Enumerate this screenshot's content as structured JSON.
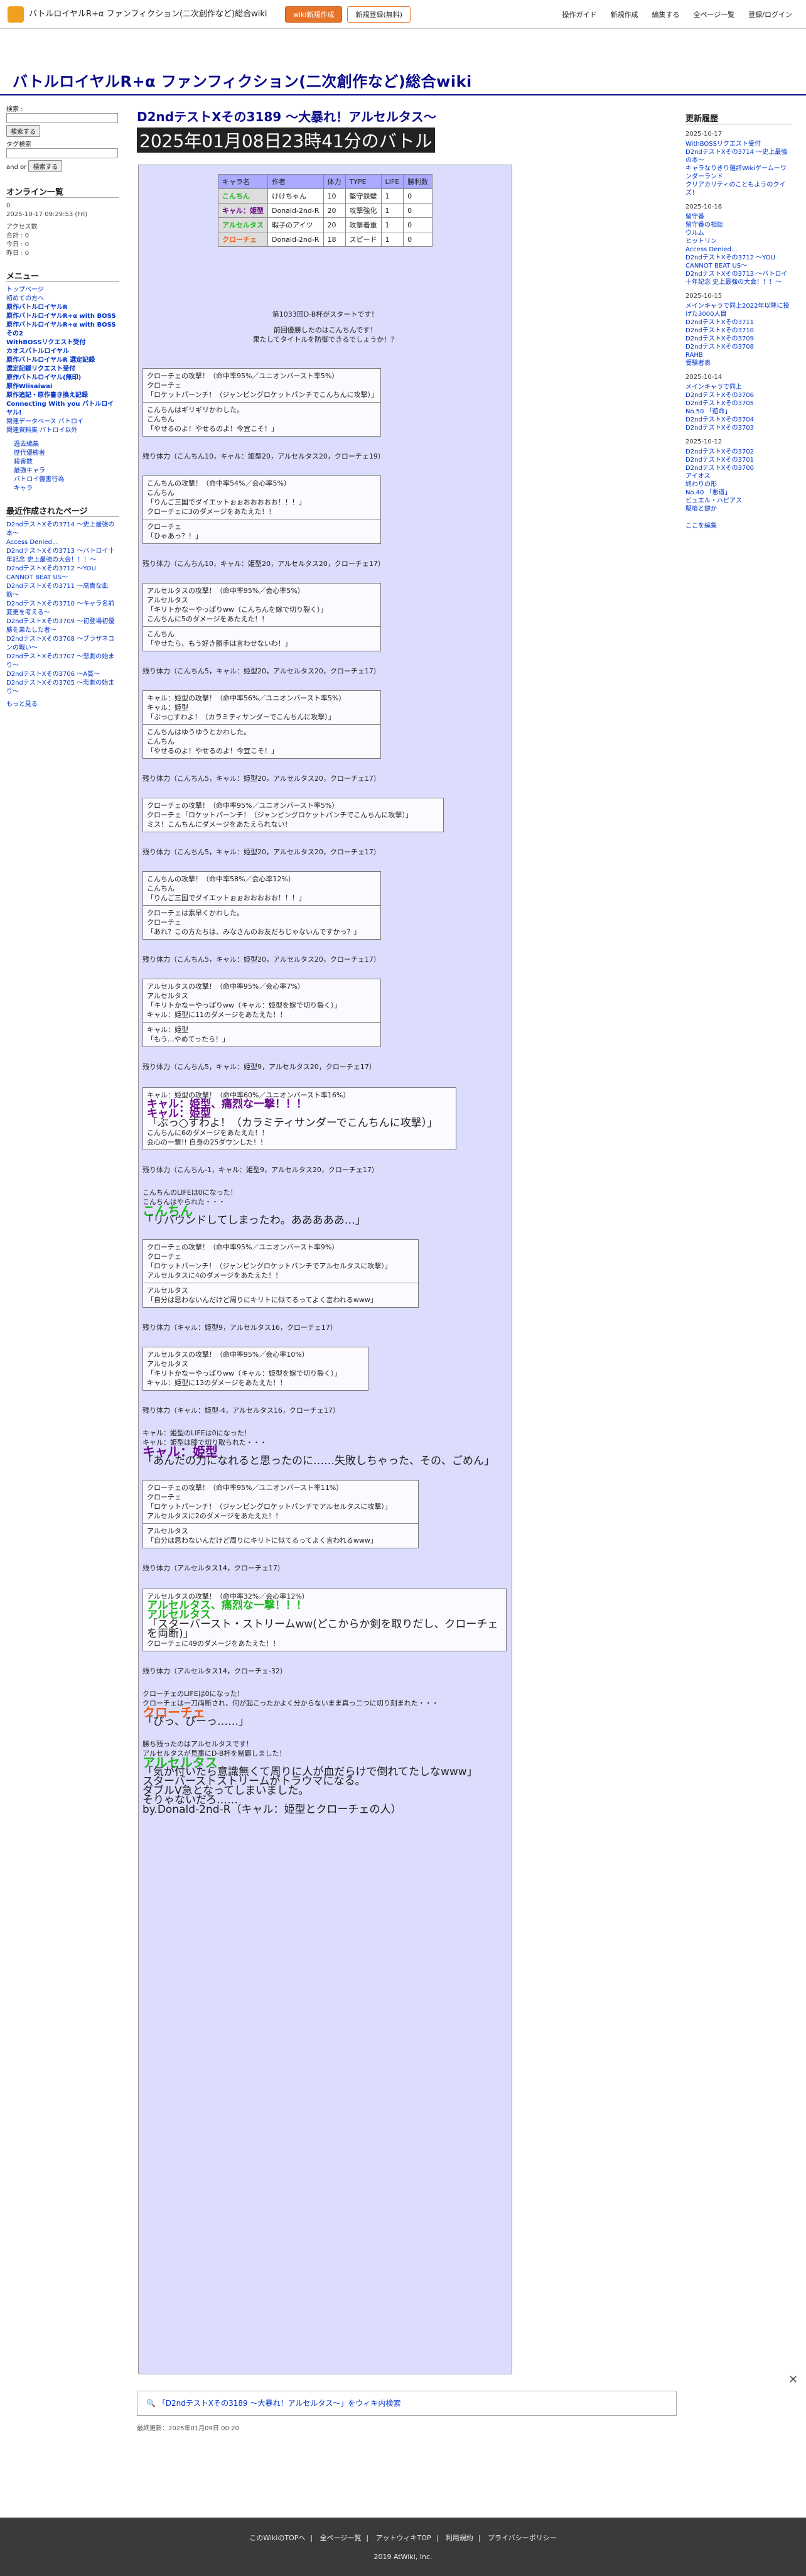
{
  "topbar": {
    "site_name": "バトルロイヤルR+α ファンフィクション(二次創作など)総合wiki",
    "btn_wiki": "wiki新規作成",
    "btn_account": "新規登録(無料)",
    "menu": [
      "操作ガイド",
      "新規作成",
      "編集する",
      "全ページ一覧",
      "登録/ログイン"
    ]
  },
  "site_title": "バトルロイヤルR+α ファンフィクション(二次創作など)総合wiki",
  "left": {
    "search_label": "検索 :",
    "search_btn": "検索する",
    "tag_label": "タグ検索",
    "and": "and",
    "or": "or",
    "online_title": "オンライン一覧",
    "online_count": "0",
    "datetime": "2025-10-17 09:29:53 (Fri)",
    "access": [
      "アクセス数",
      "合計 : 0",
      "今日 : 0",
      "昨日 : 0"
    ],
    "menu_title": "メニュー",
    "menu_items": [
      "トップページ",
      "初めての方へ",
      "原作バトルロイヤルR",
      "原作バトルロイヤルR+α with BOSS",
      "原作バトルロイヤルR+α with BOSSその2",
      "WithBOSSリクエスト受付",
      "カオスバトルロイヤル",
      "原作バトルロイヤルR 選定記録",
      "選定記録リクエスト受付",
      "原作バトルロイヤル(無印)",
      "原作Wiisaiwai",
      "原作追記・原作書き換え記録",
      "Connecting With you バトルロイヤル!",
      "関連データベース バトロイ",
      "関連資料集 バトロイ以外"
    ],
    "subitems": [
      "過去編集",
      "歴代優勝者",
      "殺害数",
      "最強キャラ",
      "バトロイ傷害行為",
      "キャラ"
    ],
    "recent_title": "最近作成されたページ",
    "recent": [
      "D2ndテストXその3714 〜史上最強の本〜",
      "Access Denied...",
      "D2ndテストXその3713 〜バトロイ十年記念 史上最強の大会！！！〜",
      "D2ndテストXその3712 〜YOU CANNOT BEAT US〜",
      "D2ndテストXその3711 〜高貴な血筋〜",
      "D2ndテストXその3710 〜キャラ名前変更を考える〜",
      "D2ndテストXその3709 〜初登場初優勝を果たした者〜",
      "D2ndテストXその3708 〜ブラザネコンの戦い〜",
      "D2ndテストXその3707 〜悲劇の始まり〜",
      "D2ndテストXその3706 〜A賞〜",
      "D2ndテストXその3705 〜悲劇の始まり〜"
    ],
    "more": "もっと見る"
  },
  "right": {
    "title": "更新履歴",
    "groups": [
      {
        "date": "2025-10-17",
        "items": [
          "WithBOSSリクエスト受付",
          "D2ndテストXその3714 〜史上最強の本〜",
          "キャラなりきり選評Wikiゲームーワンダーランド",
          "クリアカリティのこともようのクイズ！"
        ]
      },
      {
        "date": "2025-10-16",
        "items": [
          "留守番",
          "留守番の相談",
          "ウルム",
          "ヒットリン",
          "Access Denied...",
          "D2ndテストXその3712 〜YOU CANNOT BEAT US〜",
          "D2ndテストXその3713 〜バトロイ十年記念 史上最強の大会！！！〜"
        ]
      },
      {
        "date": "2025-10-15",
        "items": [
          "メインキャラで同上2022年以降に投げた3000人目",
          "D2ndテストXその3711",
          "D2ndテストXその3710",
          "D2ndテストXその3709",
          "D2ndテストXその3708",
          "RAHB",
          "受験者表"
        ]
      },
      {
        "date": "2025-10-14",
        "items": [
          "メインキャラで同上",
          "D2ndテストXその3706",
          "D2ndテストXその3705",
          "No.50 「遊命」",
          "D2ndテストXその3704",
          "D2ndテストXその3703"
        ]
      },
      {
        "date": "2025-10-12",
        "items": [
          "D2ndテストXその3702",
          "D2ndテストXその3701",
          "D2ndテストXその3700",
          "アイオス",
          "終わりの形",
          "No.40 「悪道」",
          "ビュエル・ハピアス",
          "駆喰と鍵か"
        ]
      }
    ],
    "more": "ここを編集"
  },
  "post": {
    "title": "D2ndテストXその3189 〜大暴れ！アルセルタス〜",
    "date": "2025年01月08日23時41分のバトル"
  },
  "table": {
    "headers": [
      "キャラ名",
      "作者",
      "体力",
      "TYPE",
      "LIFE",
      "勝利数"
    ],
    "rows": [
      [
        "こんちん",
        "けけちゃん",
        "10",
        "堅守鉄壁",
        "1",
        "0"
      ],
      [
        "キャル：姫型",
        "Donald-2nd-R",
        "20",
        "攻撃強化",
        "1",
        "0"
      ],
      [
        "アルセルタス",
        "暇子のアイツ",
        "20",
        "攻撃着重",
        "1",
        "0"
      ],
      [
        "クローチェ",
        "Donald-2nd-R",
        "18",
        "スピード",
        "1",
        "0"
      ]
    ]
  },
  "intro": {
    "line1": "第1033回D-B杯がスタートです！",
    "line2": "前回優勝したのはこんちんです！",
    "line3": "果たしてタイトルを防御できるでしょうか！？"
  },
  "rounds": [
    {
      "blocks": [
        [
          "クローチェの攻撃！（命中率95%／ユニオンバースト率5%）",
          "クローチェ",
          "「ロケットパーンチ！（ジャンピングロケットパンチでこんちんに攻撃）」"
        ],
        [
          "こんちんはギリギリかわした。",
          "こんちん",
          "「やせるのよ！やせるのよ！今宜こそ！」"
        ]
      ],
      "hp": "残り体力（こんちん10，キャル：姫型20，アルセルタス20，クローチェ19）"
    },
    {
      "blocks": [
        [
          "こんちんの攻撃！（命中率54%／会心率5%）",
          "こんちん",
          "「りんご三国でダイエットぉぉおおおおお！！！」",
          "クローチェに3のダメージをあたえた！！"
        ],
        [
          "クローチェ",
          "「ひゃあっ？！」"
        ]
      ],
      "hp": "残り体力（こんちん10，キャル：姫型20，アルセルタス20，クローチェ17）"
    },
    {
      "blocks": [
        [
          "アルセルタスの攻撃！（命中率95%／会心率5%）",
          "アルセルタス",
          "「キリトかなーやっぱりww（こんちんを嫁で切り裂く）」",
          "こんちんに5のダメージをあたえた！！"
        ],
        [
          "こんちん",
          "「やせたら、もう好き勝手は言わせないわ！」"
        ]
      ],
      "hp": "残り体力（こんちん5，キャル：姫型20，アルセルタス20，クローチェ17）"
    },
    {
      "blocks": [
        [
          "キャル：姫型の攻撃！（命中率56%／ユニオンバースト率5%）",
          "キャル：姫型",
          "「ぶっ○すわよ！（カラミティサンダーでこんちんに攻撃）」"
        ],
        [
          "こんちんはゆうゆうとかわした。",
          "こんちん",
          "「やせるのよ！やせるのよ！今宜こそ！」"
        ]
      ],
      "hp": "残り体力（こんちん5，キャル：姫型20，アルセルタス20，クローチェ17）"
    },
    {
      "blocks": [
        [
          "クローチェの攻撃！（命中率95%／ユニオンバースト率5%）",
          "クローチェ「ロケットパーンチ！（ジャンピングロケットパンチでこんちんに攻撃）」",
          "ミス！こんちんにダメージをあたえられない！"
        ]
      ],
      "hp": "残り体力（こんちん5，キャル：姫型20，アルセルタス20，クローチェ17）"
    },
    {
      "blocks": [
        [
          "こんちんの攻撃！（命中率58%／会心率12%）",
          "こんちん",
          "「りんご三国でダイエットぉぉおおおおお！！！」"
        ],
        [
          "クローチェは素早くかわした。",
          "クローチェ",
          "「あれ？この方たちは、みなさんのお友だちじゃないんですかっ？」"
        ]
      ],
      "hp": "残り体力（こんちん5，キャル：姫型20，アルセルタス20，クローチェ17）"
    },
    {
      "blocks": [
        [
          "アルセルタスの攻撃！（命中率95%／会心率7%）",
          "アルセルタス",
          "「キリトかなーやっぱりww（キャル：姫型を嫁で切り裂く）」",
          "キャル：姫型に11のダメージをあたえた！！"
        ],
        [
          "キャル：姫型",
          "「もう…やめてったら！」"
        ]
      ],
      "hp": "残り体力（こんちん5，キャル：姫型9，アルセルタス20，クローチェ17）"
    }
  ],
  "crit1": {
    "head": "キャル：姫型の攻撃！（命中率60%／ユニオンバースト率16%）",
    "l1": "キャル：姫型、痛烈な一撃！！！",
    "l2": "キャル：姫型",
    "l3": "「ぶっ○すわよ！（カラミティサンダーでこんちんに攻撃）」",
    "l4": "こんちんに6のダメージをあたえた！！",
    "l5": "会心の一撃!! 自身の25ダウンした！！"
  },
  "hp_after_crit1": "残り体力（こんちん-1，キャル：姫型9，アルセルタス20，クローチェ17）",
  "death1": {
    "l1": "こんちんのLIFEは0になった！",
    "l2": "こんちんはやられた・・・",
    "name": "こんちん",
    "quote": "「リバウンドしてしまったわ。あああああ…」"
  },
  "round8": {
    "blocks": [
      [
        "クローチェの攻撃！（命中率95%／ユニオンバースト率9%）",
        "クローチェ",
        "「ロケットパーンチ！（ジャンピングロケットパンチでアルセルタスに攻撃）」",
        "アルセルタスに4のダメージをあたえた！！"
      ],
      [
        "アルセルタス",
        "「自分は思わないんだけど周りにキリトに似てるってよく言われるwww」"
      ]
    ],
    "hp": "残り体力（キャル：姫型9，アルセルタス16，クローチェ17）"
  },
  "round9": {
    "blocks": [
      [
        "アルセルタスの攻撃！（命中率95%／会心率10%）",
        "アルセルタス",
        "「キリトかなーやっぱりww（キャル：姫型を嫁で切り裂く）」",
        "キャル：姫型に13のダメージをあたえた！！"
      ]
    ],
    "hp": "残り体力（キャル：姫型-4，アルセルタス16，クローチェ17）"
  },
  "death2": {
    "l1": "キャル：姫型のLIFEは0になった！",
    "l2": "キャル：姫型は膝で切り取られた・・・",
    "name": "キャル：姫型",
    "quote": "「あんたの力になれると思ったのに……失敗しちゃった、その、ごめん」"
  },
  "round10": {
    "blocks": [
      [
        "クローチェの攻撃！（命中率95%／ユニオンバースト率11%）",
        "クローチェ",
        "「ロケットパーンチ！（ジャンピングロケットパンチでアルセルタスに攻撃）」",
        "アルセルタスに2のダメージをあたえた！！"
      ],
      [
        "アルセルタス",
        "「自分は思わないんだけど周りにキリトに似てるってよく言われるwww」"
      ]
    ],
    "hp": "残り体力（アルセルタス14，クローチェ17）"
  },
  "crit2": {
    "head": "アルセルタスの攻撃！（命中率32%／会心率12%）",
    "l1": "アルセルタス、痛烈な一撃！！！",
    "l2": "アルセルタス",
    "l3": "「スターバースト・ストリームww(どこからか剣を取りだし、クローチェを両断)」",
    "l4": "クローチェに49のダメージをあたえた！！"
  },
  "hp_after_crit2": "残り体力（アルセルタス14，クローチェ-32）",
  "death3": {
    "l1": "クローチェのLIFEは0になった！",
    "l2": "クローチェは一刀両断され、何が起こったかよく分からないまま真っ二つに切り刻まれた・・・",
    "name": "クローチェ",
    "quote": "「ぴっ、ぴーっ……」"
  },
  "winner": {
    "l1": "勝ち残ったのはアルセルタスです！",
    "l2": "アルセルタスが見事にD-B杯を制覇しました！",
    "name": "アルセルタス",
    "quote": "「気が付いたら意識無くて周りに人が血だらけで倒れてたしなwww」",
    "t1": "スターバーストストリームがトラウマになる。",
    "t2": "ダブルV急となってしまいました。",
    "t3": "そりゃないだろ……",
    "by": "by.Donald-2nd-R（キャル：姫型とクローチェの人）"
  },
  "wiki_search": "「D2ndテストXその3189 〜大暴れ！アルセルタス〜」をウィキ内検索",
  "updated": "最終更新：2025年01月09日 00:20",
  "footer": {
    "links": [
      "このWikiのTOPへ",
      "全ページ一覧",
      "アットウィキTOP",
      "利用規約",
      "プライバシーポリシー"
    ],
    "copy": "2019 AtWiki, Inc."
  }
}
